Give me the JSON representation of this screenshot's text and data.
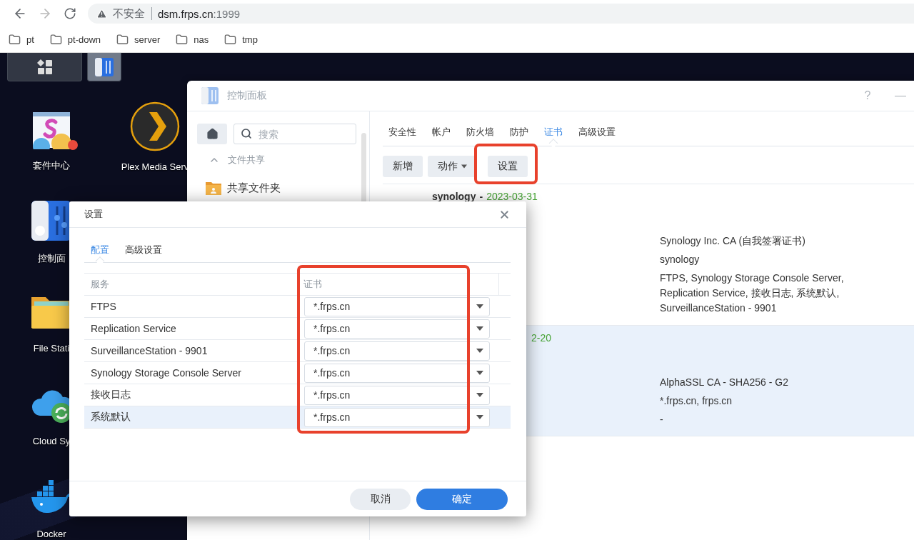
{
  "browser": {
    "nav_buttons": [
      {
        "kind": "back",
        "disabled": false
      },
      {
        "kind": "forward",
        "disabled": true
      },
      {
        "kind": "reload",
        "disabled": false
      }
    ],
    "address_bar": {
      "security": "不安全",
      "host": "dsm.frps.cn",
      "port": ":1999"
    },
    "bookmarks": [
      "pt",
      "pt-down",
      "server",
      "nas",
      "tmp"
    ]
  },
  "taskbar": {
    "items": [
      {
        "kind": "main-menu",
        "selected": false
      },
      {
        "kind": "control-panel",
        "selected": true
      }
    ]
  },
  "desktop_icons": [
    {
      "kind": "package-center",
      "label": "套件中心",
      "badge": true
    },
    {
      "kind": "plex",
      "label": "Plex Media Serv",
      "badge": false
    },
    {
      "kind": "control-panel",
      "label": "控制面",
      "badge": false
    },
    {
      "kind": "file-station",
      "label": "File Stati",
      "badge": false
    },
    {
      "kind": "cloud-sync",
      "label": "Cloud Sy",
      "badge": false
    },
    {
      "kind": "docker",
      "label": "Docker",
      "badge": false
    }
  ],
  "control_panel": {
    "title": "控制面板",
    "title_buttons": [
      "?",
      "—"
    ],
    "sidebar": {
      "search_placeholder": "搜索",
      "sections": [
        {
          "label": "文件共享",
          "expanded": true,
          "items": [
            {
              "label": "共享文件夹",
              "selected": false
            }
          ]
        }
      ]
    },
    "tabs": [
      {
        "label": "安全性",
        "selected": false
      },
      {
        "label": "帐户",
        "selected": false
      },
      {
        "label": "防火墙",
        "selected": false
      },
      {
        "label": "防护",
        "selected": false
      },
      {
        "label": "证书",
        "selected": true
      },
      {
        "label": "高级设置",
        "selected": false
      }
    ],
    "toolbar": [
      {
        "label": "新增",
        "dropdown": false
      },
      {
        "label": "动作",
        "dropdown": true
      },
      {
        "label": "设置",
        "dropdown": false
      }
    ],
    "certificates": [
      {
        "name": "synology",
        "separator": "-",
        "expiry": "2023-03-31",
        "selected": false,
        "details": [
          "Synology Inc. CA (自我签署证书)",
          "synology",
          "FTPS, Synology Storage Console Server,\nReplication Service, 接收日志, 系统默认,\nSurveillanceStation - 9901"
        ]
      },
      {
        "expiry": "2-20",
        "selected": true,
        "details": [
          "AlphaSSL CA - SHA256 - G2",
          "*.frps.cn, frps.cn",
          "-"
        ]
      }
    ]
  },
  "dialog": {
    "title": "设置",
    "tabs": [
      {
        "label": "配置",
        "selected": true
      },
      {
        "label": "高级设置",
        "selected": false
      }
    ],
    "columns": [
      "服务",
      "证书"
    ],
    "rows": [
      {
        "service": "FTPS",
        "certificate": "*.frps.cn",
        "selected": false
      },
      {
        "service": "Replication Service",
        "certificate": "*.frps.cn",
        "selected": false
      },
      {
        "service": "SurveillanceStation - 9901",
        "certificate": "*.frps.cn",
        "selected": false
      },
      {
        "service": "Synology Storage Console Server",
        "certificate": "*.frps.cn",
        "selected": false
      },
      {
        "service": "接收日志",
        "certificate": "*.frps.cn",
        "selected": false
      },
      {
        "service": "系统默认",
        "certificate": "*.frps.cn",
        "selected": true
      }
    ],
    "buttons": [
      {
        "label": "取消",
        "kind": "secondary"
      },
      {
        "label": "确定",
        "kind": "primary"
      }
    ]
  }
}
